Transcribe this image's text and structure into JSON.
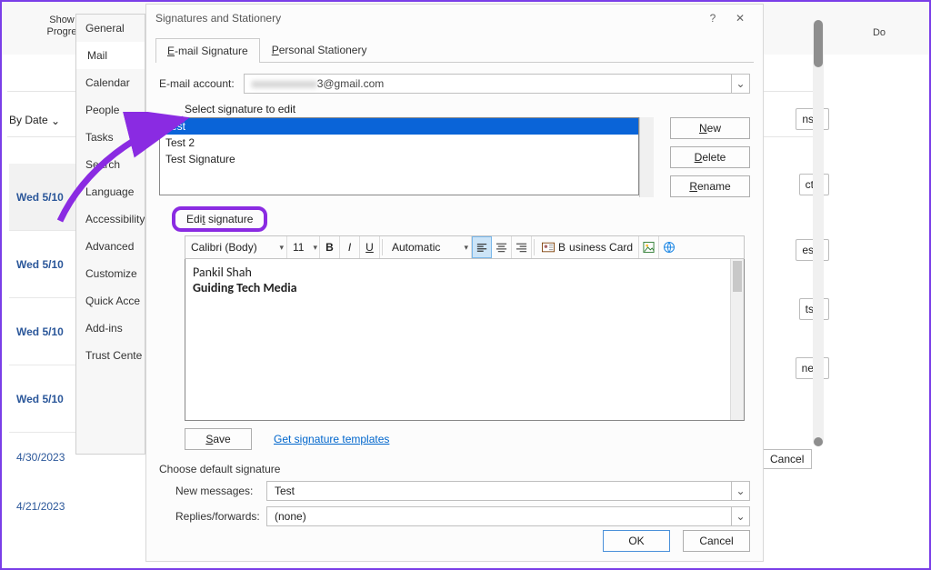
{
  "ribbon": {
    "show_label": "Show\nProgre",
    "down_label": "Do"
  },
  "sort": {
    "label": "By Date",
    "chev": "⌄"
  },
  "mail_items": [
    {
      "date": "Wed 5/10",
      "grey": true
    },
    {
      "date": "Wed 5/10"
    },
    {
      "date": "Wed 5/10"
    },
    {
      "date": "Wed 5/10"
    },
    {
      "date": "4/30/2023",
      "plain": true
    },
    {
      "date": "4/21/2023",
      "plain": true
    }
  ],
  "categories": [
    "General",
    "Mail",
    "Calendar",
    "People",
    "Tasks",
    "Search",
    "Language",
    "Accessibility",
    "Advanced",
    "Customize",
    "Quick Acce",
    "Add-ins",
    "Trust Cente"
  ],
  "categories_selected": 1,
  "dialog": {
    "title": "Signatures and Stationery",
    "help": "?",
    "close": "✕",
    "tabs": {
      "sig": "E-mail Signature",
      "stat": "Personal Stationery"
    },
    "email_label": "E-mail account:",
    "email_value": "3@gmail.com",
    "select_label": "Select signature to edit",
    "sigs": [
      "Test",
      "Test 2",
      "Test Signature"
    ],
    "sig_selected": 0,
    "btns": {
      "new": "New",
      "delete": "Delete",
      "rename": "Rename"
    },
    "edit_label": "Edit signature",
    "toolbar": {
      "font": "Calibri (Body)",
      "size": "11",
      "color": "Automatic",
      "biz": "Business Card"
    },
    "editor": {
      "line1": "Pankil Shah",
      "line2": "Guiding Tech Media"
    },
    "save": "Save",
    "templates": "Get signature templates",
    "defaults_label": "Choose default signature",
    "new_msg_label": "New messages:",
    "new_msg_value": "Test",
    "reply_label": "Replies/forwards:",
    "reply_value": "(none)",
    "ok": "OK",
    "cancel": "Cancel"
  },
  "opts": {
    "a": "ns...",
    "b": "ct...",
    "c": "es...",
    "d": "ts...",
    "e": "ne...",
    "cancel": "Cancel"
  }
}
